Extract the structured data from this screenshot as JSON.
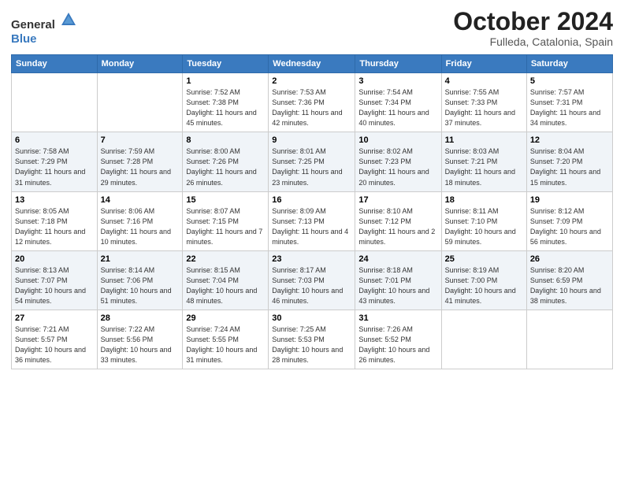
{
  "header": {
    "logo_general": "General",
    "logo_blue": "Blue",
    "month_title": "October 2024",
    "subtitle": "Fulleda, Catalonia, Spain"
  },
  "days_of_week": [
    "Sunday",
    "Monday",
    "Tuesday",
    "Wednesday",
    "Thursday",
    "Friday",
    "Saturday"
  ],
  "weeks": [
    [
      {
        "day": "",
        "empty": true
      },
      {
        "day": "",
        "empty": true
      },
      {
        "day": "1",
        "sunrise": "Sunrise: 7:52 AM",
        "sunset": "Sunset: 7:38 PM",
        "daylight": "Daylight: 11 hours and 45 minutes."
      },
      {
        "day": "2",
        "sunrise": "Sunrise: 7:53 AM",
        "sunset": "Sunset: 7:36 PM",
        "daylight": "Daylight: 11 hours and 42 minutes."
      },
      {
        "day": "3",
        "sunrise": "Sunrise: 7:54 AM",
        "sunset": "Sunset: 7:34 PM",
        "daylight": "Daylight: 11 hours and 40 minutes."
      },
      {
        "day": "4",
        "sunrise": "Sunrise: 7:55 AM",
        "sunset": "Sunset: 7:33 PM",
        "daylight": "Daylight: 11 hours and 37 minutes."
      },
      {
        "day": "5",
        "sunrise": "Sunrise: 7:57 AM",
        "sunset": "Sunset: 7:31 PM",
        "daylight": "Daylight: 11 hours and 34 minutes."
      }
    ],
    [
      {
        "day": "6",
        "sunrise": "Sunrise: 7:58 AM",
        "sunset": "Sunset: 7:29 PM",
        "daylight": "Daylight: 11 hours and 31 minutes."
      },
      {
        "day": "7",
        "sunrise": "Sunrise: 7:59 AM",
        "sunset": "Sunset: 7:28 PM",
        "daylight": "Daylight: 11 hours and 29 minutes."
      },
      {
        "day": "8",
        "sunrise": "Sunrise: 8:00 AM",
        "sunset": "Sunset: 7:26 PM",
        "daylight": "Daylight: 11 hours and 26 minutes."
      },
      {
        "day": "9",
        "sunrise": "Sunrise: 8:01 AM",
        "sunset": "Sunset: 7:25 PM",
        "daylight": "Daylight: 11 hours and 23 minutes."
      },
      {
        "day": "10",
        "sunrise": "Sunrise: 8:02 AM",
        "sunset": "Sunset: 7:23 PM",
        "daylight": "Daylight: 11 hours and 20 minutes."
      },
      {
        "day": "11",
        "sunrise": "Sunrise: 8:03 AM",
        "sunset": "Sunset: 7:21 PM",
        "daylight": "Daylight: 11 hours and 18 minutes."
      },
      {
        "day": "12",
        "sunrise": "Sunrise: 8:04 AM",
        "sunset": "Sunset: 7:20 PM",
        "daylight": "Daylight: 11 hours and 15 minutes."
      }
    ],
    [
      {
        "day": "13",
        "sunrise": "Sunrise: 8:05 AM",
        "sunset": "Sunset: 7:18 PM",
        "daylight": "Daylight: 11 hours and 12 minutes."
      },
      {
        "day": "14",
        "sunrise": "Sunrise: 8:06 AM",
        "sunset": "Sunset: 7:16 PM",
        "daylight": "Daylight: 11 hours and 10 minutes."
      },
      {
        "day": "15",
        "sunrise": "Sunrise: 8:07 AM",
        "sunset": "Sunset: 7:15 PM",
        "daylight": "Daylight: 11 hours and 7 minutes."
      },
      {
        "day": "16",
        "sunrise": "Sunrise: 8:09 AM",
        "sunset": "Sunset: 7:13 PM",
        "daylight": "Daylight: 11 hours and 4 minutes."
      },
      {
        "day": "17",
        "sunrise": "Sunrise: 8:10 AM",
        "sunset": "Sunset: 7:12 PM",
        "daylight": "Daylight: 11 hours and 2 minutes."
      },
      {
        "day": "18",
        "sunrise": "Sunrise: 8:11 AM",
        "sunset": "Sunset: 7:10 PM",
        "daylight": "Daylight: 10 hours and 59 minutes."
      },
      {
        "day": "19",
        "sunrise": "Sunrise: 8:12 AM",
        "sunset": "Sunset: 7:09 PM",
        "daylight": "Daylight: 10 hours and 56 minutes."
      }
    ],
    [
      {
        "day": "20",
        "sunrise": "Sunrise: 8:13 AM",
        "sunset": "Sunset: 7:07 PM",
        "daylight": "Daylight: 10 hours and 54 minutes."
      },
      {
        "day": "21",
        "sunrise": "Sunrise: 8:14 AM",
        "sunset": "Sunset: 7:06 PM",
        "daylight": "Daylight: 10 hours and 51 minutes."
      },
      {
        "day": "22",
        "sunrise": "Sunrise: 8:15 AM",
        "sunset": "Sunset: 7:04 PM",
        "daylight": "Daylight: 10 hours and 48 minutes."
      },
      {
        "day": "23",
        "sunrise": "Sunrise: 8:17 AM",
        "sunset": "Sunset: 7:03 PM",
        "daylight": "Daylight: 10 hours and 46 minutes."
      },
      {
        "day": "24",
        "sunrise": "Sunrise: 8:18 AM",
        "sunset": "Sunset: 7:01 PM",
        "daylight": "Daylight: 10 hours and 43 minutes."
      },
      {
        "day": "25",
        "sunrise": "Sunrise: 8:19 AM",
        "sunset": "Sunset: 7:00 PM",
        "daylight": "Daylight: 10 hours and 41 minutes."
      },
      {
        "day": "26",
        "sunrise": "Sunrise: 8:20 AM",
        "sunset": "Sunset: 6:59 PM",
        "daylight": "Daylight: 10 hours and 38 minutes."
      }
    ],
    [
      {
        "day": "27",
        "sunrise": "Sunrise: 7:21 AM",
        "sunset": "Sunset: 5:57 PM",
        "daylight": "Daylight: 10 hours and 36 minutes."
      },
      {
        "day": "28",
        "sunrise": "Sunrise: 7:22 AM",
        "sunset": "Sunset: 5:56 PM",
        "daylight": "Daylight: 10 hours and 33 minutes."
      },
      {
        "day": "29",
        "sunrise": "Sunrise: 7:24 AM",
        "sunset": "Sunset: 5:55 PM",
        "daylight": "Daylight: 10 hours and 31 minutes."
      },
      {
        "day": "30",
        "sunrise": "Sunrise: 7:25 AM",
        "sunset": "Sunset: 5:53 PM",
        "daylight": "Daylight: 10 hours and 28 minutes."
      },
      {
        "day": "31",
        "sunrise": "Sunrise: 7:26 AM",
        "sunset": "Sunset: 5:52 PM",
        "daylight": "Daylight: 10 hours and 26 minutes."
      },
      {
        "day": "",
        "empty": true
      },
      {
        "day": "",
        "empty": true
      }
    ]
  ]
}
